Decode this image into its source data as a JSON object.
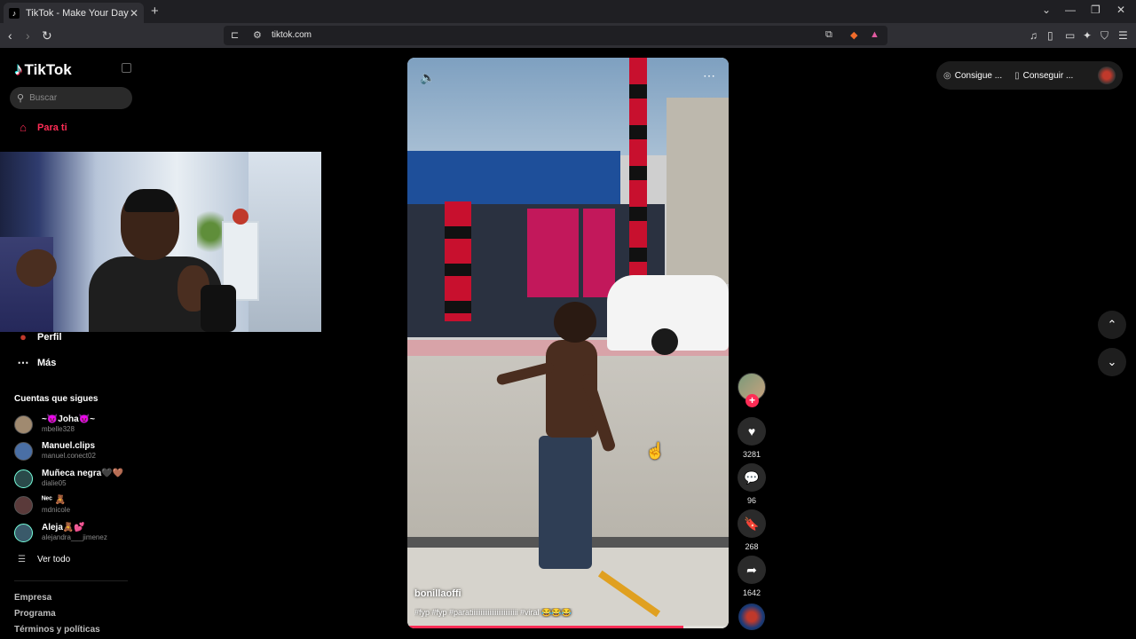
{
  "browser": {
    "tab_title": "TikTok - Make Your Day",
    "url": "tiktok.com"
  },
  "sidebar": {
    "logo_text": "TikTok",
    "search_placeholder": "Buscar",
    "nav": [
      {
        "label": "Para ti",
        "icon": "home-icon",
        "active": true
      },
      {
        "label": "Perfil",
        "icon": "profile-icon"
      },
      {
        "label": "Más",
        "icon": "more-dots-icon"
      }
    ],
    "following_title": "Cuentas que sigues",
    "accounts": [
      {
        "name": "~😈Joha😈~",
        "handle": "mbelle328"
      },
      {
        "name": "Manuel.clips",
        "handle": "manuel.conect02"
      },
      {
        "name": "Muñeca negra🖤🤎",
        "handle": "dialie05"
      },
      {
        "name": "ᴺᵉᶜ 🧸",
        "handle": "mdnicole"
      },
      {
        "name": "Aleja🧸💕",
        "handle": "alejandra___jimenez"
      }
    ],
    "see_all": "Ver todo",
    "footer": [
      "Empresa",
      "Programa",
      "Términos y políticas"
    ]
  },
  "video": {
    "author": "bonillaoffi",
    "caption": "#fyp #fyp #paratiiiiiiiiiiiiiiiiiiiiiiiiii #viral 😂😂😂",
    "progress": 0.86
  },
  "actions": {
    "likes": "3281",
    "comments": "96",
    "saves": "268",
    "shares": "1642"
  },
  "topright": {
    "btn1": "Consigue ...",
    "btn2": "Conseguir ..."
  },
  "colors": {
    "accent": "#fe2c55"
  }
}
